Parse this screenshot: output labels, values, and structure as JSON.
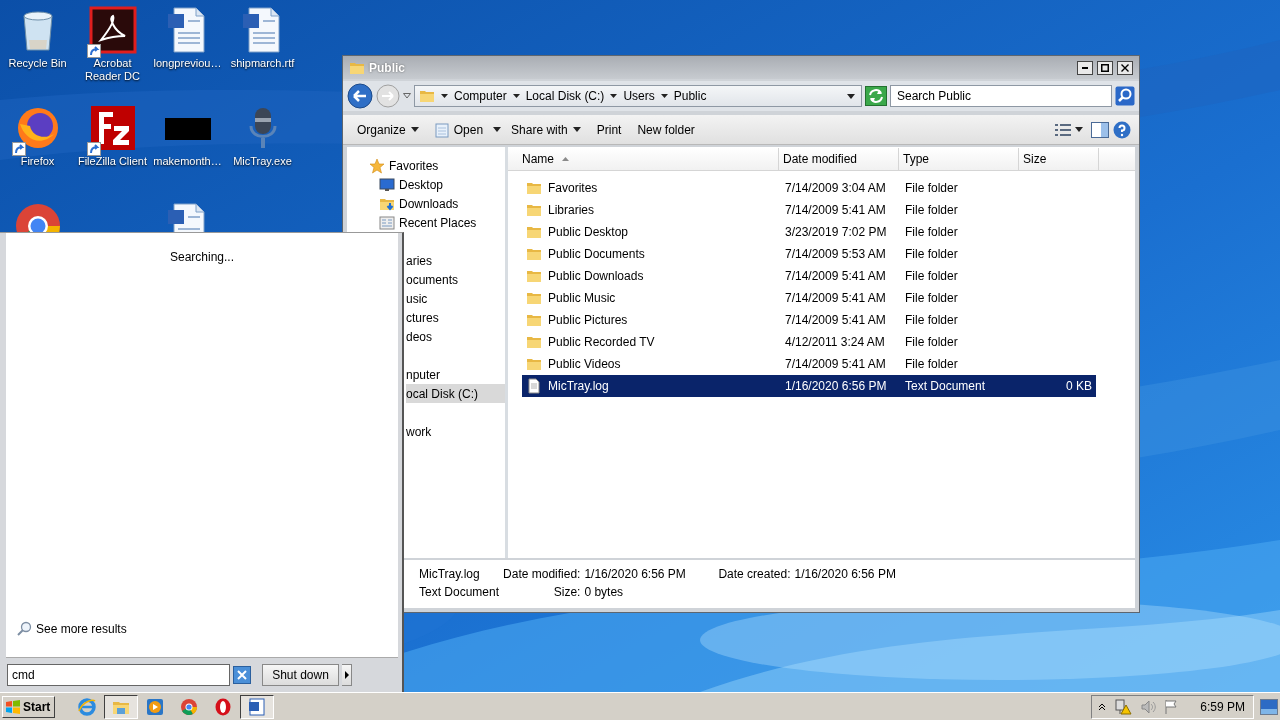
{
  "desktop_columns": [
    [
      {
        "label": "Recycle Bin",
        "kind": "recycle",
        "shortcut": false
      },
      {
        "label": "Firefox",
        "kind": "firefox",
        "shortcut": true
      },
      {
        "kind": "chrome",
        "shortcut": false
      }
    ],
    [
      {
        "label": "Acrobat Reader DC",
        "kind": "pdf",
        "shortcut": true
      },
      {
        "label": "FileZilla Client",
        "kind": "filezilla",
        "shortcut": true
      }
    ],
    [
      {
        "label": "longpreviou…",
        "kind": "word",
        "shortcut": false
      },
      {
        "label": "makemonth…",
        "kind": "thumb",
        "shortcut": false
      },
      {
        "kind": "word",
        "shortcut": false
      }
    ],
    [
      {
        "label": "shipmarch.rtf",
        "kind": "word",
        "shortcut": false
      },
      {
        "label": "MicTray.exe",
        "kind": "mic",
        "shortcut": false
      }
    ]
  ],
  "explorer": {
    "title": "Public",
    "breadcrumb": [
      "Computer",
      "Local Disk (C:)",
      "Users",
      "Public"
    ],
    "search": {
      "placeholder": "Search Public"
    },
    "toolbar": [
      {
        "label": "Organize",
        "kind": "menu"
      },
      {
        "label": "Open",
        "kind": "open"
      },
      {
        "label": "Share with",
        "kind": "menu"
      },
      {
        "label": "Print",
        "kind": "plain"
      },
      {
        "label": "New folder",
        "kind": "plain"
      }
    ],
    "nav": [
      {
        "label": "Favorites",
        "kind": "favorites",
        "selected": false,
        "children": [
          {
            "label": "Desktop",
            "kind": "desktop",
            "selected": false
          },
          {
            "label": "Downloads",
            "kind": "downloads",
            "selected": false
          },
          {
            "label": "Recent Places",
            "kind": "recent",
            "selected": false
          }
        ]
      },
      {
        "label": "aries",
        "selected": false,
        "children": [
          {
            "label": "ocuments",
            "selected": false
          },
          {
            "label": "usic",
            "selected": false
          },
          {
            "label": "ctures",
            "selected": false
          },
          {
            "label": "deos",
            "selected": false
          }
        ]
      },
      {
        "label": "nputer",
        "selected": false,
        "children": [
          {
            "label": "ocal Disk (C:)",
            "selected": true
          }
        ]
      },
      {
        "label": "work",
        "selected": false
      }
    ],
    "columns": [
      {
        "label": "Name",
        "sorted": true
      },
      {
        "label": "Date modified",
        "sorted": false
      },
      {
        "label": "Type",
        "sorted": false
      },
      {
        "label": "Size",
        "sorted": false
      }
    ],
    "rows": [
      {
        "name": "Favorites",
        "kind": "folder",
        "date": "7/14/2009 3:04 AM",
        "type": "File folder",
        "selected": false
      },
      {
        "name": "Libraries",
        "kind": "folder",
        "date": "7/14/2009 5:41 AM",
        "type": "File folder",
        "selected": false
      },
      {
        "name": "Public Desktop",
        "kind": "folder",
        "date": "3/23/2019 7:02 PM",
        "type": "File folder",
        "selected": false
      },
      {
        "name": "Public Documents",
        "kind": "folder",
        "date": "7/14/2009 5:53 AM",
        "type": "File folder",
        "selected": false
      },
      {
        "name": "Public Downloads",
        "kind": "folder",
        "date": "7/14/2009 5:41 AM",
        "type": "File folder",
        "selected": false
      },
      {
        "name": "Public Music",
        "kind": "folder",
        "date": "7/14/2009 5:41 AM",
        "type": "File folder",
        "selected": false
      },
      {
        "name": "Public Pictures",
        "kind": "folder",
        "date": "7/14/2009 5:41 AM",
        "type": "File folder",
        "selected": false
      },
      {
        "name": "Public Recorded TV",
        "kind": "folder",
        "date": "4/12/2011 3:24 AM",
        "type": "File folder",
        "selected": false
      },
      {
        "name": "Public Videos",
        "kind": "folder",
        "date": "7/14/2009 5:41 AM",
        "type": "File folder",
        "selected": false
      },
      {
        "name": "MicTray.log",
        "kind": "file",
        "date": "1/16/2020 6:56 PM",
        "type": "Text Document",
        "size": "0 KB",
        "selected": true
      }
    ],
    "details": {
      "name": "MicTray.log",
      "type": "Text Document",
      "modified_label": "Date modified:",
      "modified": "1/16/2020 6:56 PM",
      "created_label": "Date created:",
      "created": "1/16/2020 6:56 PM",
      "size_label": "Size:",
      "size": "0 bytes"
    }
  },
  "start_menu": {
    "status": "Searching...",
    "more_results": "See more results",
    "search_value": "cmd",
    "shutdown": "Shut down"
  },
  "taskbar": {
    "start": "Start",
    "apps": [
      {
        "kind": "ie",
        "active": false
      },
      {
        "kind": "explorer",
        "active": true
      },
      {
        "kind": "media",
        "active": false
      },
      {
        "kind": "chrome",
        "active": false
      },
      {
        "kind": "opera",
        "active": false
      },
      {
        "kind": "word",
        "active": true
      }
    ],
    "clock": "6:59 PM"
  }
}
